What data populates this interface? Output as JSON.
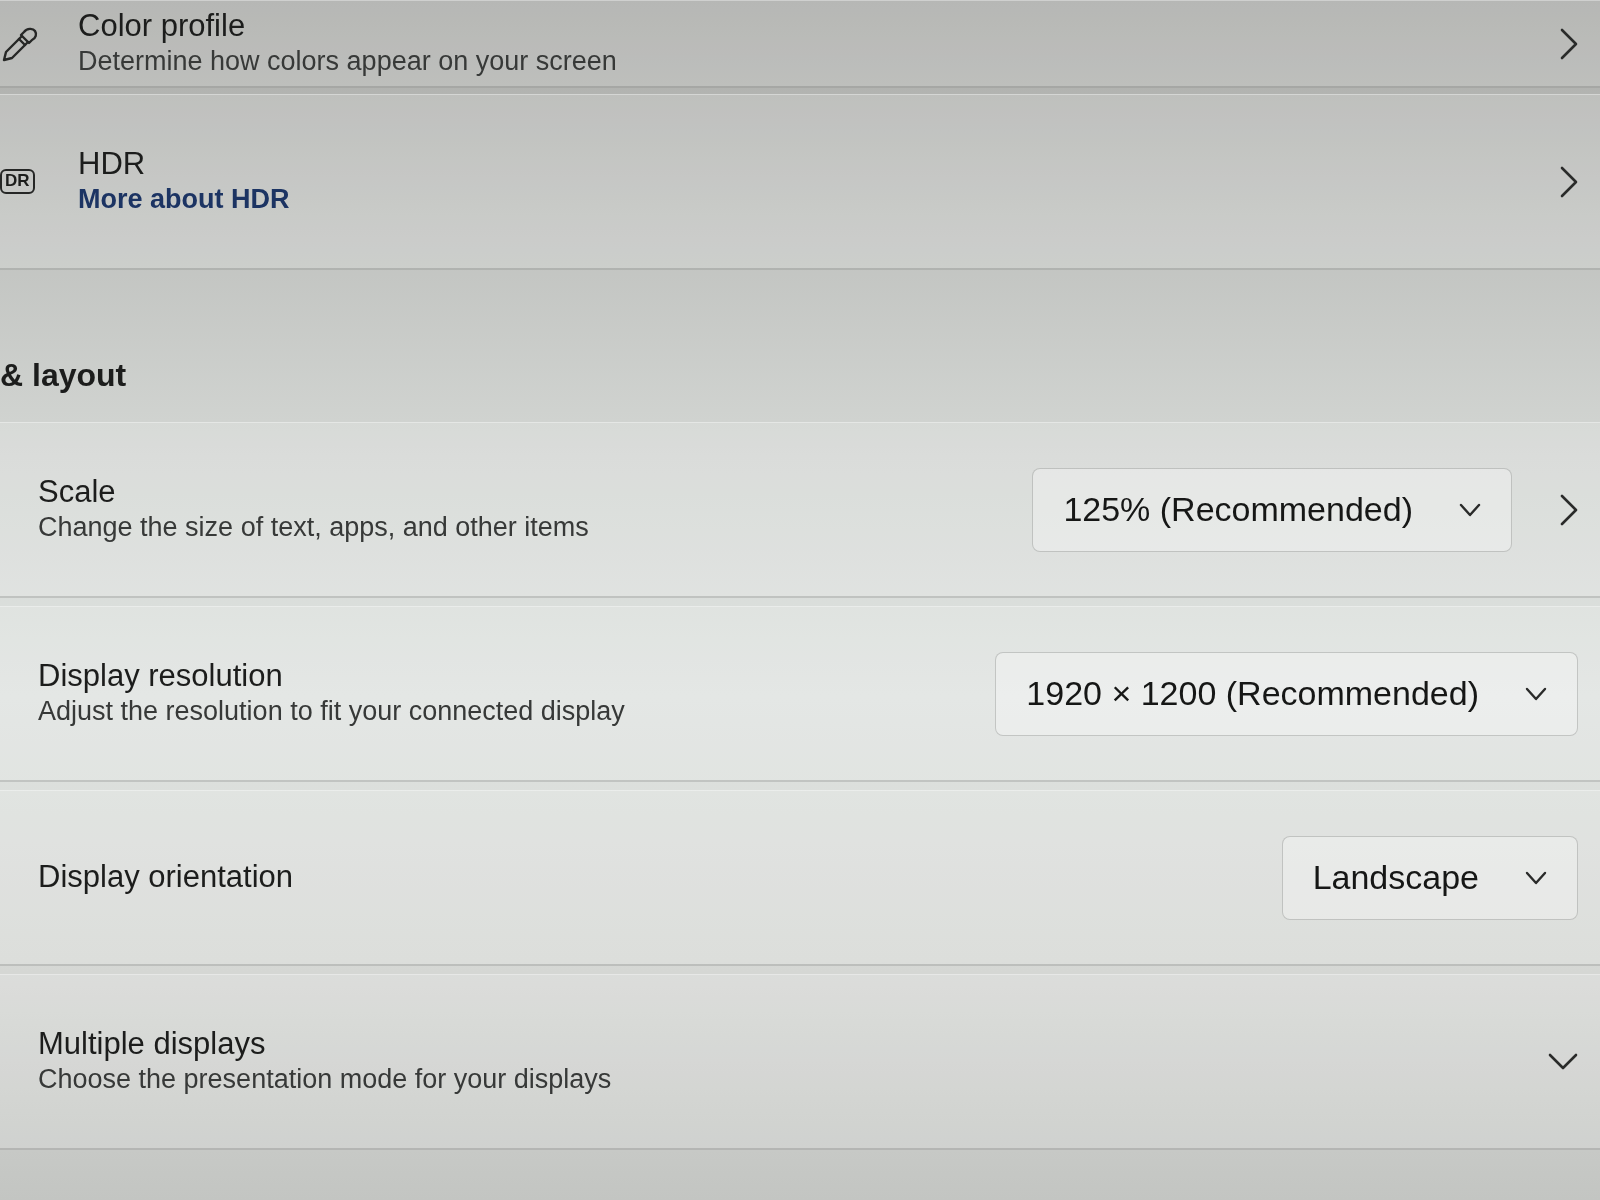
{
  "settings": [
    {
      "kind": "link",
      "title": "Color profile",
      "subtitle": "Determine how colors appear on your screen"
    },
    {
      "kind": "link",
      "badge": "DR",
      "title": "HDR",
      "link": "More about HDR"
    }
  ],
  "section_title": "& layout",
  "layout_settings": [
    {
      "kind": "dropdown_link",
      "title": "Scale",
      "subtitle": "Change the size of text, apps, and other items",
      "value": "125% (Recommended)"
    },
    {
      "kind": "dropdown",
      "title": "Display resolution",
      "subtitle": "Adjust the resolution to fit your connected display",
      "value": "1920 × 1200 (Recommended)"
    },
    {
      "kind": "dropdown",
      "title": "Display orientation",
      "value": "Landscape"
    },
    {
      "kind": "expander",
      "title": "Multiple displays",
      "subtitle": "Choose the presentation mode for your displays",
      "expanded": false
    }
  ]
}
